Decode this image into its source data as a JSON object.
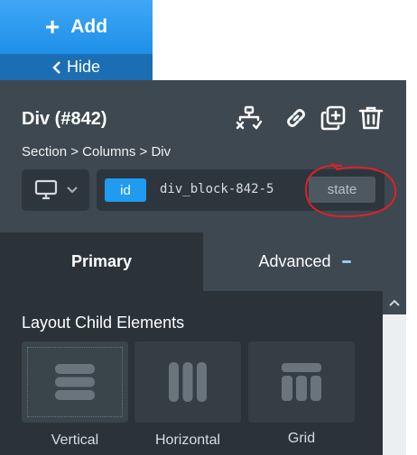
{
  "topbar": {
    "add_label": "Add",
    "hide_label": "Hide"
  },
  "header": {
    "title": "Div (#842)",
    "breadcrumb": [
      "Section",
      "Columns",
      "Div"
    ],
    "breadcrumb_separator": ">",
    "icons": [
      "structure-icon",
      "link-icon",
      "duplicate-icon",
      "delete-icon"
    ]
  },
  "selector": {
    "device": "desktop",
    "badge": "id",
    "value": "div_block-842-5",
    "state_label": "state"
  },
  "tabs": [
    {
      "label": "Primary",
      "active": true
    },
    {
      "label": "Advanced",
      "active": false
    }
  ],
  "layout": {
    "heading": "Layout Child Elements",
    "options": [
      {
        "label": "Vertical",
        "selected": true,
        "icon": "vertical-layout-icon"
      },
      {
        "label": "Horizontal",
        "selected": false,
        "icon": "horizontal-layout-icon"
      },
      {
        "label": "Grid",
        "selected": false,
        "icon": "grid-layout-icon"
      }
    ]
  },
  "colors": {
    "accent": "#1f9bf0",
    "add_button": "#2a98ef",
    "hide_button": "#1c6eb4",
    "header_bg": "#3e4850",
    "panel_bg": "#2b3338",
    "annotation": "#e0202a"
  }
}
